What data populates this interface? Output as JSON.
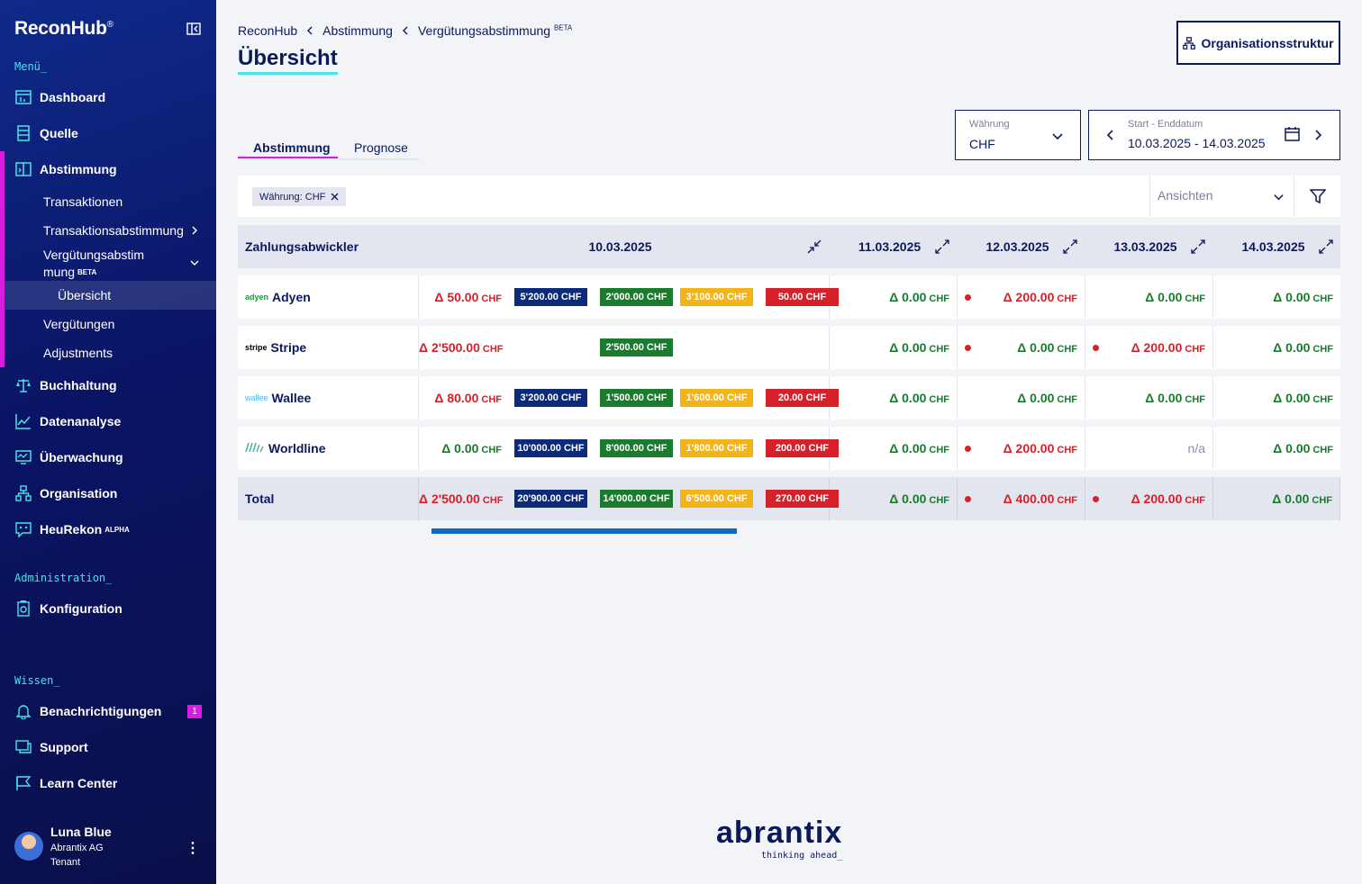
{
  "app": {
    "name": "ReconHub",
    "reg": "®"
  },
  "sidebar": {
    "menu_label": "Menü_",
    "items": [
      {
        "label": "Dashboard",
        "icon": "dashboard-icon"
      },
      {
        "label": "Quelle",
        "icon": "source-icon"
      },
      {
        "label": "Abstimmung",
        "icon": "reconcile-icon"
      }
    ],
    "sub_items": [
      {
        "label": "Transaktionen"
      },
      {
        "label": "Transaktionsabstimmung"
      },
      {
        "label": "Vergütungsabstim",
        "label2": "mung",
        "badge": "BETA"
      },
      {
        "label": "Übersicht"
      },
      {
        "label": "Vergütungen"
      },
      {
        "label": "Adjustments"
      }
    ],
    "items2": [
      {
        "label": "Buchhaltung",
        "icon": "scale-icon"
      },
      {
        "label": "Datenanalyse",
        "icon": "chart-icon"
      },
      {
        "label": "Überwachung",
        "icon": "monitor-icon"
      },
      {
        "label": "Organisation",
        "icon": "org-icon"
      },
      {
        "label": "HeuRekon",
        "badge": "ALPHA",
        "icon": "bot-icon"
      }
    ],
    "admin_label": "Administration_",
    "admin_items": [
      {
        "label": "Konfiguration",
        "icon": "config-icon"
      }
    ],
    "knowledge_label": "Wissen_",
    "knowledge_items": [
      {
        "label": "Benachrichtigungen",
        "badge": "1",
        "icon": "bell-icon"
      },
      {
        "label": "Support",
        "icon": "support-icon"
      },
      {
        "label": "Learn Center",
        "icon": "learn-icon"
      }
    ],
    "user": {
      "name": "Luna Blue",
      "org": "Abrantix AG",
      "tenant": "Tenant"
    }
  },
  "header": {
    "breadcrumb": [
      "ReconHub",
      "Abstimmung",
      "Vergütungsabstimmung"
    ],
    "breadcrumb_badge": "BETA",
    "title": "Übersicht",
    "org_button": "Organisationsstruktur"
  },
  "tabs": [
    "Abstimmung",
    "Prognose"
  ],
  "currency": {
    "label": "Währung",
    "value": "CHF"
  },
  "daterange": {
    "label": "Start - Enddatum",
    "value": "10.03.2025 - 14.03.2025"
  },
  "filter": {
    "chip": "Währung: CHF",
    "views_placeholder": "Ansichten"
  },
  "table": {
    "headers": [
      "Zahlungsabwickler",
      "10.03.2025",
      "11.03.2025",
      "12.03.2025",
      "13.03.2025",
      "14.03.2025"
    ],
    "rows": [
      {
        "logo": "adyen",
        "name": "Adyen",
        "d1": "Δ 50.00",
        "d1c": "red",
        "pills": [
          "5'200.00 CHF",
          "2'000.00 CHF",
          "3'100.00 CHF",
          "50.00 CHF"
        ],
        "d2": "Δ 0.00",
        "d2c": "green",
        "dot2": false,
        "d3": "Δ 200.00",
        "d3c": "red",
        "dot3": true,
        "d4": "Δ 0.00",
        "d4c": "green",
        "dot4": false,
        "d5": "Δ 0.00",
        "d5c": "green"
      },
      {
        "logo": "stripe",
        "name": "Stripe",
        "d1": "Δ 2'500.00",
        "d1c": "red",
        "pills": [
          "",
          "2'500.00 CHF",
          "",
          ""
        ],
        "d2": "Δ 0.00",
        "d2c": "green",
        "dot2": false,
        "d3": "Δ 0.00",
        "d3c": "green",
        "dot3": true,
        "d4": "Δ 200.00",
        "d4c": "red",
        "dot4": true,
        "d5": "Δ 0.00",
        "d5c": "green"
      },
      {
        "logo": "wallee",
        "name": "Wallee",
        "d1": "Δ 80.00",
        "d1c": "red",
        "pills": [
          "3'200.00 CHF",
          "1'500.00 CHF",
          "1'600.00 CHF",
          "20.00 CHF"
        ],
        "d2": "Δ 0.00",
        "d2c": "green",
        "dot2": false,
        "d3": "Δ 0.00",
        "d3c": "green",
        "dot3": false,
        "d4": "Δ 0.00",
        "d4c": "green",
        "dot4": false,
        "d5": "Δ 0.00",
        "d5c": "green"
      },
      {
        "logo": "",
        "name": "Worldline",
        "d1": "Δ 0.00",
        "d1c": "green",
        "pills": [
          "10'000.00 CHF",
          "8'000.00 CHF",
          "1'800.00 CHF",
          "200.00 CHF"
        ],
        "d2": "Δ 0.00",
        "d2c": "green",
        "dot2": false,
        "d3": "Δ 200.00",
        "d3c": "red",
        "dot3": true,
        "d4": "n/a",
        "d4c": "gray",
        "dot4": false,
        "d5": "Δ 0.00",
        "d5c": "green"
      }
    ],
    "total": {
      "name": "Total",
      "d1": "Δ 2'500.00",
      "d1c": "red",
      "pills": [
        "20'900.00 CHF",
        "14'000.00 CHF",
        "6'500.00 CHF",
        "270.00 CHF"
      ],
      "d2": "Δ 0.00",
      "d2c": "green",
      "dot2": false,
      "d3": "Δ 400.00",
      "d3c": "red",
      "dot3": true,
      "d4": "Δ 200.00",
      "d4c": "red",
      "dot4": true,
      "d5": "Δ 0.00",
      "d5c": "green"
    },
    "currency_suffix": "CHF"
  },
  "footer": {
    "brand": "abrantix",
    "tagline": "thinking ahead_"
  },
  "colors": {
    "navy": "#0b1a5c",
    "accent": "#d81ce0",
    "cyan": "#49e3e8",
    "green": "#1a7a2e",
    "red": "#d6202a",
    "yellow": "#f2b416"
  }
}
